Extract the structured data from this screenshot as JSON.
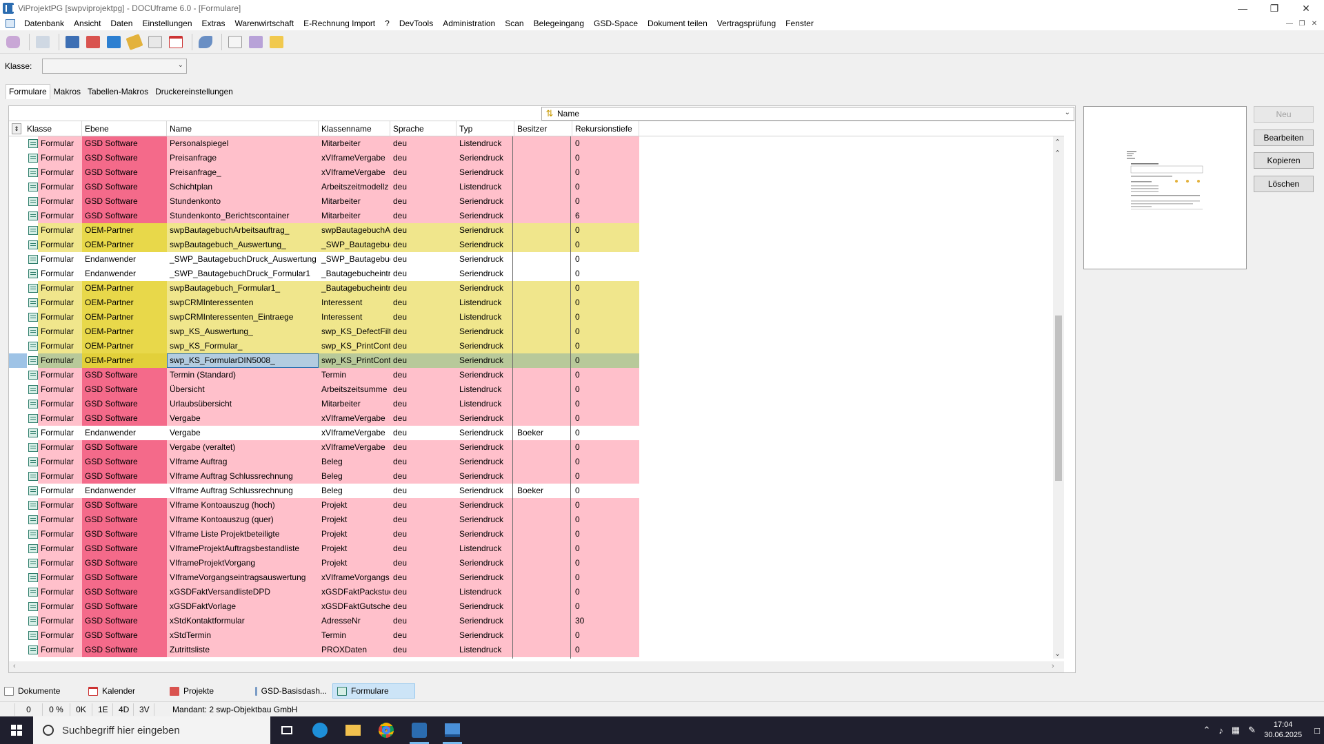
{
  "window": {
    "title": "ViProjektPG [swpviprojektpg] - DOCUframe 6.0 - [Formulare]"
  },
  "menu": [
    "Datenbank",
    "Ansicht",
    "Daten",
    "Einstellungen",
    "Extras",
    "Warenwirtschaft",
    "E-Rechnung Import",
    "?",
    "DevTools",
    "Administration",
    "Scan",
    "Belegeingang",
    "GSD-Space",
    "Dokument teilen",
    "Vertragsprüfung",
    "Fenster"
  ],
  "klasse": {
    "label": "Klasse:",
    "value": ""
  },
  "tabs": [
    "Formulare",
    "Makros",
    "Tabellen-Makros",
    "Druckereinstellungen"
  ],
  "sort": {
    "field": "Name"
  },
  "columns": [
    "Klasse",
    "Ebene",
    "Name",
    "Klassenname",
    "Sprache",
    "Typ",
    "Besitzer",
    "Rekursionstiefe"
  ],
  "rows": [
    {
      "klasse": "Formular",
      "ebene": "GSD Software",
      "name": "Personalspiegel",
      "klassenname": "Mitarbeiter",
      "sprache": "deu",
      "typ": "Listendruck",
      "besitzer": "",
      "rek": "0",
      "color": "pink"
    },
    {
      "klasse": "Formular",
      "ebene": "GSD Software",
      "name": "Preisanfrage",
      "klassenname": "xVIframeVergabe",
      "sprache": "deu",
      "typ": "Seriendruck",
      "besitzer": "",
      "rek": "0",
      "color": "pink"
    },
    {
      "klasse": "Formular",
      "ebene": "GSD Software",
      "name": "Preisanfrage_",
      "klassenname": "xVIframeVergabe",
      "sprache": "deu",
      "typ": "Seriendruck",
      "besitzer": "",
      "rek": "0",
      "color": "pink"
    },
    {
      "klasse": "Formular",
      "ebene": "GSD Software",
      "name": "Schichtplan",
      "klassenname": "Arbeitszeitmodellz",
      "sprache": "deu",
      "typ": "Listendruck",
      "besitzer": "",
      "rek": "0",
      "color": "pink"
    },
    {
      "klasse": "Formular",
      "ebene": "GSD Software",
      "name": "Stundenkonto",
      "klassenname": "Mitarbeiter",
      "sprache": "deu",
      "typ": "Seriendruck",
      "besitzer": "",
      "rek": "0",
      "color": "pink"
    },
    {
      "klasse": "Formular",
      "ebene": "GSD Software",
      "name": "Stundenkonto_Berichtscontainer",
      "klassenname": "Mitarbeiter",
      "sprache": "deu",
      "typ": "Seriendruck",
      "besitzer": "",
      "rek": "6",
      "color": "pink"
    },
    {
      "klasse": "Formular",
      "ebene": "OEM-Partner",
      "name": "swpBautagebuchArbeitsauftrag_",
      "klassenname": "swpBautagebuchA",
      "sprache": "deu",
      "typ": "Seriendruck",
      "besitzer": "",
      "rek": "0",
      "color": "yellow"
    },
    {
      "klasse": "Formular",
      "ebene": "OEM-Partner",
      "name": "swpBautagebuch_Auswertung_",
      "klassenname": "_SWP_Bautagebuc",
      "sprache": "deu",
      "typ": "Seriendruck",
      "besitzer": "",
      "rek": "0",
      "color": "yellow"
    },
    {
      "klasse": "Formular",
      "ebene": "Endanwender",
      "name": "_SWP_BautagebuchDruck_Auswertung",
      "klassenname": "_SWP_Bautagebuc",
      "sprache": "deu",
      "typ": "Seriendruck",
      "besitzer": "",
      "rek": "0",
      "color": "white"
    },
    {
      "klasse": "Formular",
      "ebene": "Endanwender",
      "name": "_SWP_BautagebuchDruck_Formular1",
      "klassenname": "_Bautagebucheintr",
      "sprache": "deu",
      "typ": "Seriendruck",
      "besitzer": "",
      "rek": "0",
      "color": "white"
    },
    {
      "klasse": "Formular",
      "ebene": "OEM-Partner",
      "name": "swpBautagebuch_Formular1_",
      "klassenname": "_Bautagebucheintr",
      "sprache": "deu",
      "typ": "Seriendruck",
      "besitzer": "",
      "rek": "0",
      "color": "yellow"
    },
    {
      "klasse": "Formular",
      "ebene": "OEM-Partner",
      "name": "swpCRMInteressenten",
      "klassenname": "Interessent",
      "sprache": "deu",
      "typ": "Listendruck",
      "besitzer": "",
      "rek": "0",
      "color": "yellow"
    },
    {
      "klasse": "Formular",
      "ebene": "OEM-Partner",
      "name": "swpCRMInteressenten_Eintraege",
      "klassenname": "Interessent",
      "sprache": "deu",
      "typ": "Listendruck",
      "besitzer": "",
      "rek": "0",
      "color": "yellow"
    },
    {
      "klasse": "Formular",
      "ebene": "OEM-Partner",
      "name": "swp_KS_Auswertung_",
      "klassenname": "swp_KS_DefectFilte",
      "sprache": "deu",
      "typ": "Seriendruck",
      "besitzer": "",
      "rek": "0",
      "color": "yellow"
    },
    {
      "klasse": "Formular",
      "ebene": "OEM-Partner",
      "name": "swp_KS_Formular_",
      "klassenname": "swp_KS_PrintConta",
      "sprache": "deu",
      "typ": "Seriendruck",
      "besitzer": "",
      "rek": "0",
      "color": "yellow"
    },
    {
      "klasse": "Formular",
      "ebene": "OEM-Partner",
      "name": "swp_KS_FormularDIN5008_",
      "klassenname": "swp_KS_PrintConta",
      "sprache": "deu",
      "typ": "Seriendruck",
      "besitzer": "",
      "rek": "0",
      "color": "selected"
    },
    {
      "klasse": "Formular",
      "ebene": "GSD Software",
      "name": "Termin (Standard)",
      "klassenname": "Termin",
      "sprache": "deu",
      "typ": "Seriendruck",
      "besitzer": "",
      "rek": "0",
      "color": "pink"
    },
    {
      "klasse": "Formular",
      "ebene": "GSD Software",
      "name": "Übersicht",
      "klassenname": "Arbeitszeitsumme",
      "sprache": "deu",
      "typ": "Listendruck",
      "besitzer": "",
      "rek": "0",
      "color": "pink"
    },
    {
      "klasse": "Formular",
      "ebene": "GSD Software",
      "name": "Urlaubsübersicht",
      "klassenname": "Mitarbeiter",
      "sprache": "deu",
      "typ": "Listendruck",
      "besitzer": "",
      "rek": "0",
      "color": "pink"
    },
    {
      "klasse": "Formular",
      "ebene": "GSD Software",
      "name": "Vergabe",
      "klassenname": "xVIframeVergabe",
      "sprache": "deu",
      "typ": "Seriendruck",
      "besitzer": "",
      "rek": "0",
      "color": "pink"
    },
    {
      "klasse": "Formular",
      "ebene": "Endanwender",
      "name": "Vergabe",
      "klassenname": "xVIframeVergabe",
      "sprache": "deu",
      "typ": "Seriendruck",
      "besitzer": "Boeker",
      "rek": "0",
      "color": "white"
    },
    {
      "klasse": "Formular",
      "ebene": "GSD Software",
      "name": "Vergabe (veraltet)",
      "klassenname": "xVIframeVergabe",
      "sprache": "deu",
      "typ": "Seriendruck",
      "besitzer": "",
      "rek": "0",
      "color": "pink"
    },
    {
      "klasse": "Formular",
      "ebene": "GSD Software",
      "name": "VIframe Auftrag",
      "klassenname": "Beleg",
      "sprache": "deu",
      "typ": "Seriendruck",
      "besitzer": "",
      "rek": "0",
      "color": "pink"
    },
    {
      "klasse": "Formular",
      "ebene": "GSD Software",
      "name": "VIframe Auftrag Schlussrechnung",
      "klassenname": "Beleg",
      "sprache": "deu",
      "typ": "Seriendruck",
      "besitzer": "",
      "rek": "0",
      "color": "pink"
    },
    {
      "klasse": "Formular",
      "ebene": "Endanwender",
      "name": "VIframe Auftrag Schlussrechnung",
      "klassenname": "Beleg",
      "sprache": "deu",
      "typ": "Seriendruck",
      "besitzer": "Boeker",
      "rek": "0",
      "color": "white"
    },
    {
      "klasse": "Formular",
      "ebene": "GSD Software",
      "name": "VIframe Kontoauszug (hoch)",
      "klassenname": "Projekt",
      "sprache": "deu",
      "typ": "Seriendruck",
      "besitzer": "",
      "rek": "0",
      "color": "pink"
    },
    {
      "klasse": "Formular",
      "ebene": "GSD Software",
      "name": "VIframe Kontoauszug (quer)",
      "klassenname": "Projekt",
      "sprache": "deu",
      "typ": "Seriendruck",
      "besitzer": "",
      "rek": "0",
      "color": "pink"
    },
    {
      "klasse": "Formular",
      "ebene": "GSD Software",
      "name": "VIframe Liste Projektbeteiligte",
      "klassenname": "Projekt",
      "sprache": "deu",
      "typ": "Seriendruck",
      "besitzer": "",
      "rek": "0",
      "color": "pink"
    },
    {
      "klasse": "Formular",
      "ebene": "GSD Software",
      "name": "VIframeProjektAuftragsbestandliste",
      "klassenname": "Projekt",
      "sprache": "deu",
      "typ": "Listendruck",
      "besitzer": "",
      "rek": "0",
      "color": "pink"
    },
    {
      "klasse": "Formular",
      "ebene": "GSD Software",
      "name": "VIframeProjektVorgang",
      "klassenname": "Projekt",
      "sprache": "deu",
      "typ": "Seriendruck",
      "besitzer": "",
      "rek": "0",
      "color": "pink"
    },
    {
      "klasse": "Formular",
      "ebene": "GSD Software",
      "name": "VIframeVorgangseintragsauswertung",
      "klassenname": "xVIframeVorgangs",
      "sprache": "deu",
      "typ": "Seriendruck",
      "besitzer": "",
      "rek": "0",
      "color": "pink"
    },
    {
      "klasse": "Formular",
      "ebene": "GSD Software",
      "name": "xGSDFaktVersandlisteDPD",
      "klassenname": "xGSDFaktPackstue",
      "sprache": "deu",
      "typ": "Listendruck",
      "besitzer": "",
      "rek": "0",
      "color": "pink"
    },
    {
      "klasse": "Formular",
      "ebene": "GSD Software",
      "name": "xGSDFaktVorlage",
      "klassenname": "xGSDFaktGutschei",
      "sprache": "deu",
      "typ": "Seriendruck",
      "besitzer": "",
      "rek": "0",
      "color": "pink"
    },
    {
      "klasse": "Formular",
      "ebene": "GSD Software",
      "name": "xStdKontaktformular",
      "klassenname": "AdresseNr",
      "sprache": "deu",
      "typ": "Seriendruck",
      "besitzer": "",
      "rek": "30",
      "color": "pink"
    },
    {
      "klasse": "Formular",
      "ebene": "GSD Software",
      "name": "xStdTermin",
      "klassenname": "Termin",
      "sprache": "deu",
      "typ": "Seriendruck",
      "besitzer": "",
      "rek": "0",
      "color": "pink"
    },
    {
      "klasse": "Formular",
      "ebene": "GSD Software",
      "name": "Zutrittsliste",
      "klassenname": "PROXDaten",
      "sprache": "deu",
      "typ": "Listendruck",
      "besitzer": "",
      "rek": "0",
      "color": "pink"
    }
  ],
  "actions": {
    "neu": "Neu",
    "bearbeiten": "Bearbeiten",
    "kopieren": "Kopieren",
    "loeschen": "Löschen"
  },
  "doc_tabs": [
    "Dokumente",
    "Kalender",
    "Projekte",
    "GSD-Basisdash...",
    "Formulare"
  ],
  "doc_tab_icons": [
    "document-icon",
    "calendar-icon",
    "projects-icon",
    "dashboard-icon",
    "forms-icon"
  ],
  "status": {
    "count": "0",
    "percent": "0 %",
    "k": "0K",
    "e": "1E",
    "d": "4D",
    "v": "3V",
    "mandant": "Mandant: 2 swp-Objektbau GmbH"
  },
  "taskbar": {
    "search_placeholder": "Suchbegriff hier eingeben",
    "time": "17:04",
    "date": "30.06.2025"
  },
  "colors": {
    "pink_row": "#ffc0cb",
    "pink_ebene": "#f46a8a",
    "yellow_row": "#f0e68c",
    "yellow_ebene": "#e8d84a",
    "selected_row": "#b8c99a"
  }
}
